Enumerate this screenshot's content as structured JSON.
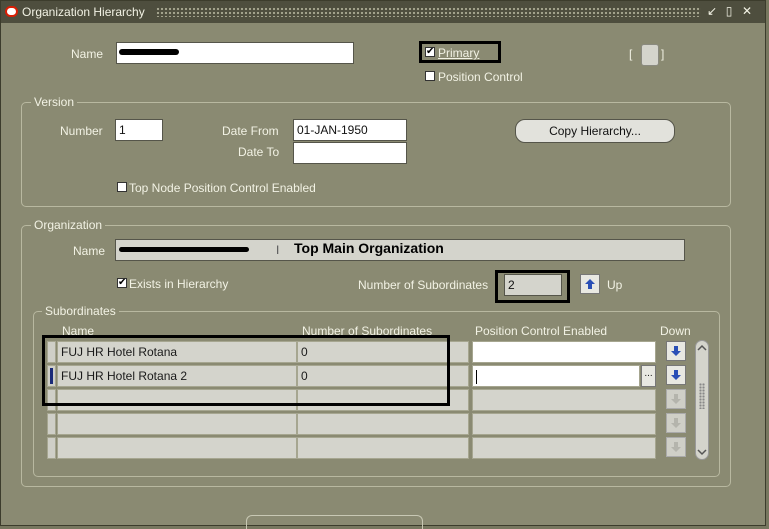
{
  "window": {
    "title": "Organization Hierarchy",
    "minimize_glyph": "↙",
    "maximize_glyph": "▯",
    "close_glyph": "✕"
  },
  "header": {
    "name_label": "Name",
    "name_value": "",
    "primary_label": "Primary",
    "primary_checked": true,
    "position_control_label": "Position Control",
    "position_control_checked": false,
    "bracket_left": "[",
    "bracket_right": "]"
  },
  "version": {
    "section_title": "Version",
    "number_label": "Number",
    "number_value": "1",
    "date_from_label": "Date From",
    "date_from_value": "01-JAN-1950",
    "date_to_label": "Date To",
    "date_to_value": "",
    "copy_button_label": "Copy Hierarchy...",
    "top_node_label": "Top Node Position Control Enabled",
    "top_node_checked": false
  },
  "organization": {
    "section_title": "Organization",
    "name_label": "Name",
    "name_annotation": "Top Main Organization",
    "exists_label": "Exists in Hierarchy",
    "exists_checked": true,
    "num_subordinates_label": "Number of Subordinates",
    "num_subordinates_value": "2",
    "up_label": "Up"
  },
  "subordinates": {
    "section_title": "Subordinates",
    "columns": [
      "Name",
      "Number of Subordinates",
      "Position Control Enabled",
      "Down"
    ],
    "rows": [
      {
        "name": "FUJ HR Hotel Rotana",
        "count": "0",
        "pce": ""
      },
      {
        "name": "FUJ HR Hotel Rotana 2",
        "count": "0",
        "pce": ""
      },
      {
        "name": "",
        "count": "",
        "pce": ""
      },
      {
        "name": "",
        "count": "",
        "pce": ""
      },
      {
        "name": "",
        "count": "",
        "pce": ""
      }
    ],
    "lov_glyph": "..."
  },
  "colors": {
    "background": "#8a8a72",
    "titlebar": "#4e4e3e",
    "accent_blue": "#2a4fb6",
    "highlight_box": "#000000"
  }
}
